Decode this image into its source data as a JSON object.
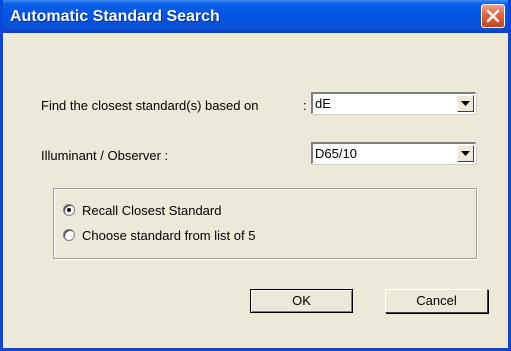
{
  "window": {
    "title": "Automatic Standard Search"
  },
  "fields": {
    "closest_label": "Find the closest standard(s) based on",
    "closest_colon": ":",
    "closest_value": "dE",
    "illuminant_label": "Illuminant / Observer :",
    "illuminant_value": "D65/10"
  },
  "options": {
    "recall": {
      "label": "Recall Closest Standard",
      "selected": true
    },
    "choose": {
      "label": "Choose standard from list of 5",
      "selected": false
    }
  },
  "buttons": {
    "ok": "OK",
    "cancel": "Cancel"
  },
  "icons": {
    "close": "close-icon",
    "dropdown": "chevron-down-icon"
  },
  "colors": {
    "titlebar": "#0054e3",
    "close_button": "#e0633f",
    "dialog_bg": "#ece9d8"
  }
}
